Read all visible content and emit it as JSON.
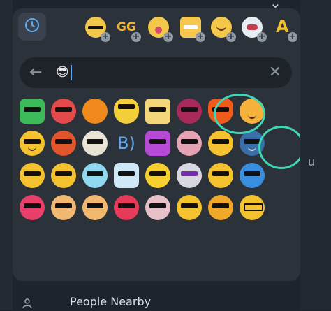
{
  "search": {
    "query_emoji": "😎"
  },
  "text": {
    "b_emoji": "B)"
  },
  "bottom": {
    "people_nearby": "People Nearby"
  },
  "colors": {
    "panel": "#2b323a",
    "search_bg": "#1d2329",
    "highlight": "#3fd6b6",
    "caret": "#5ea7f1"
  },
  "packs": [
    {
      "icon": "cool-face-pack"
    },
    {
      "icon": "gg-text-pack"
    },
    {
      "icon": "silly-face-pack"
    },
    {
      "icon": "grin-face-pack"
    },
    {
      "icon": "wink-face-pack"
    },
    {
      "icon": "robot-face-pack"
    },
    {
      "icon": "letter-a-pack"
    }
  ]
}
